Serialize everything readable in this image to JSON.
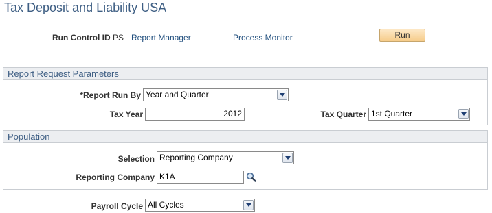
{
  "page": {
    "title": "Tax Deposit and Liability USA"
  },
  "run_control": {
    "label": "Run Control ID",
    "value": "PS",
    "report_manager_link": "Report Manager",
    "process_monitor_link": "Process Monitor",
    "run_button": "Run"
  },
  "report_params": {
    "header": "Report Request Parameters",
    "report_run_by_label": "*Report Run By",
    "report_run_by_value": "Year and Quarter",
    "tax_year_label": "Tax Year",
    "tax_year_value": "2012",
    "tax_quarter_label": "Tax Quarter",
    "tax_quarter_value": "1st Quarter"
  },
  "population": {
    "header": "Population",
    "selection_label": "Selection",
    "selection_value": "Reporting Company",
    "reporting_company_label": "Reporting Company",
    "reporting_company_value": "K1A"
  },
  "payroll": {
    "label": "Payroll Cycle",
    "value": "All Cycles"
  },
  "icons": {
    "lookup": "magnifier-icon",
    "dropdown": "chevron-down-icon"
  },
  "colors": {
    "title": "#3f5f84",
    "link": "#214f7e",
    "run_button": "#f6cc8a",
    "group_header_bg": "#eceef1"
  }
}
